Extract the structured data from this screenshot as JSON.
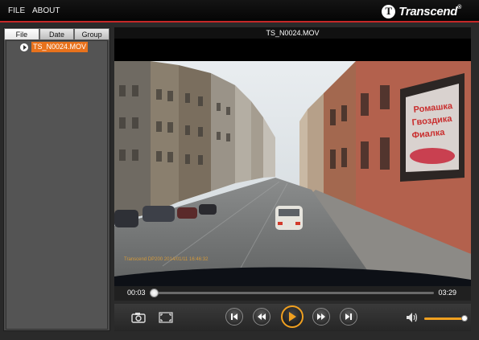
{
  "menu": {
    "file": "FILE",
    "about": "ABOUT"
  },
  "brand": {
    "name": "Transcend",
    "reg": "®",
    "logo_letter": "T"
  },
  "sidebar": {
    "tabs": [
      {
        "label": "File"
      },
      {
        "label": "Date"
      },
      {
        "label": "Group"
      }
    ],
    "active_tab": "File",
    "files": [
      {
        "name": "TS_N0024.MOV",
        "selected": true
      }
    ]
  },
  "player": {
    "title": "TS_N0024.MOV",
    "current_time": "00:03",
    "total_time": "03:29",
    "progress": 0.015,
    "volume": 0.95,
    "accent_color": "#f0a020"
  },
  "icons": {
    "snapshot": "camera-icon",
    "fullscreen": "fullscreen-icon",
    "prev": "skip-previous-icon",
    "rewind": "rewind-icon",
    "play": "play-icon",
    "forward": "fast-forward-icon",
    "next": "skip-next-icon",
    "volume": "volume-icon"
  }
}
